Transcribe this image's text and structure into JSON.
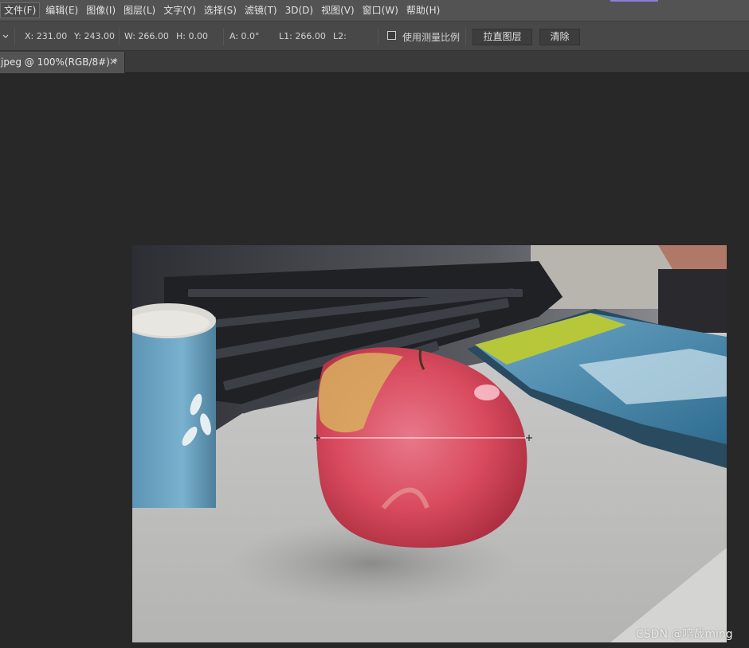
{
  "menubar": {
    "items": [
      "文件(F)",
      "编辑(E)",
      "图像(I)",
      "图层(L)",
      "文字(Y)",
      "选择(S)",
      "滤镜(T)",
      "3D(D)",
      "视图(V)",
      "窗口(W)",
      "帮助(H)"
    ]
  },
  "options": {
    "x": "X: 231.00",
    "y": "Y: 243.00",
    "w": "W: 266.00",
    "h": "H: 0.00",
    "a": "A: 0.0°",
    "l1": "L1: 266.00",
    "l2": "L2:",
    "use_scale_label": "使用测量比例",
    "use_scale_checked": false,
    "straighten_label": "拉直图层",
    "clear_label": "清除"
  },
  "document": {
    "tab_title": "jpeg @ 100%(RGB/8#) *",
    "close_glyph": "×"
  },
  "watermark": "CSDN @鸣哉ming",
  "colors": {
    "menubar": "#535353",
    "optionsbar": "#484848",
    "canvas": "#282828",
    "accent": "#8a7fd6"
  }
}
